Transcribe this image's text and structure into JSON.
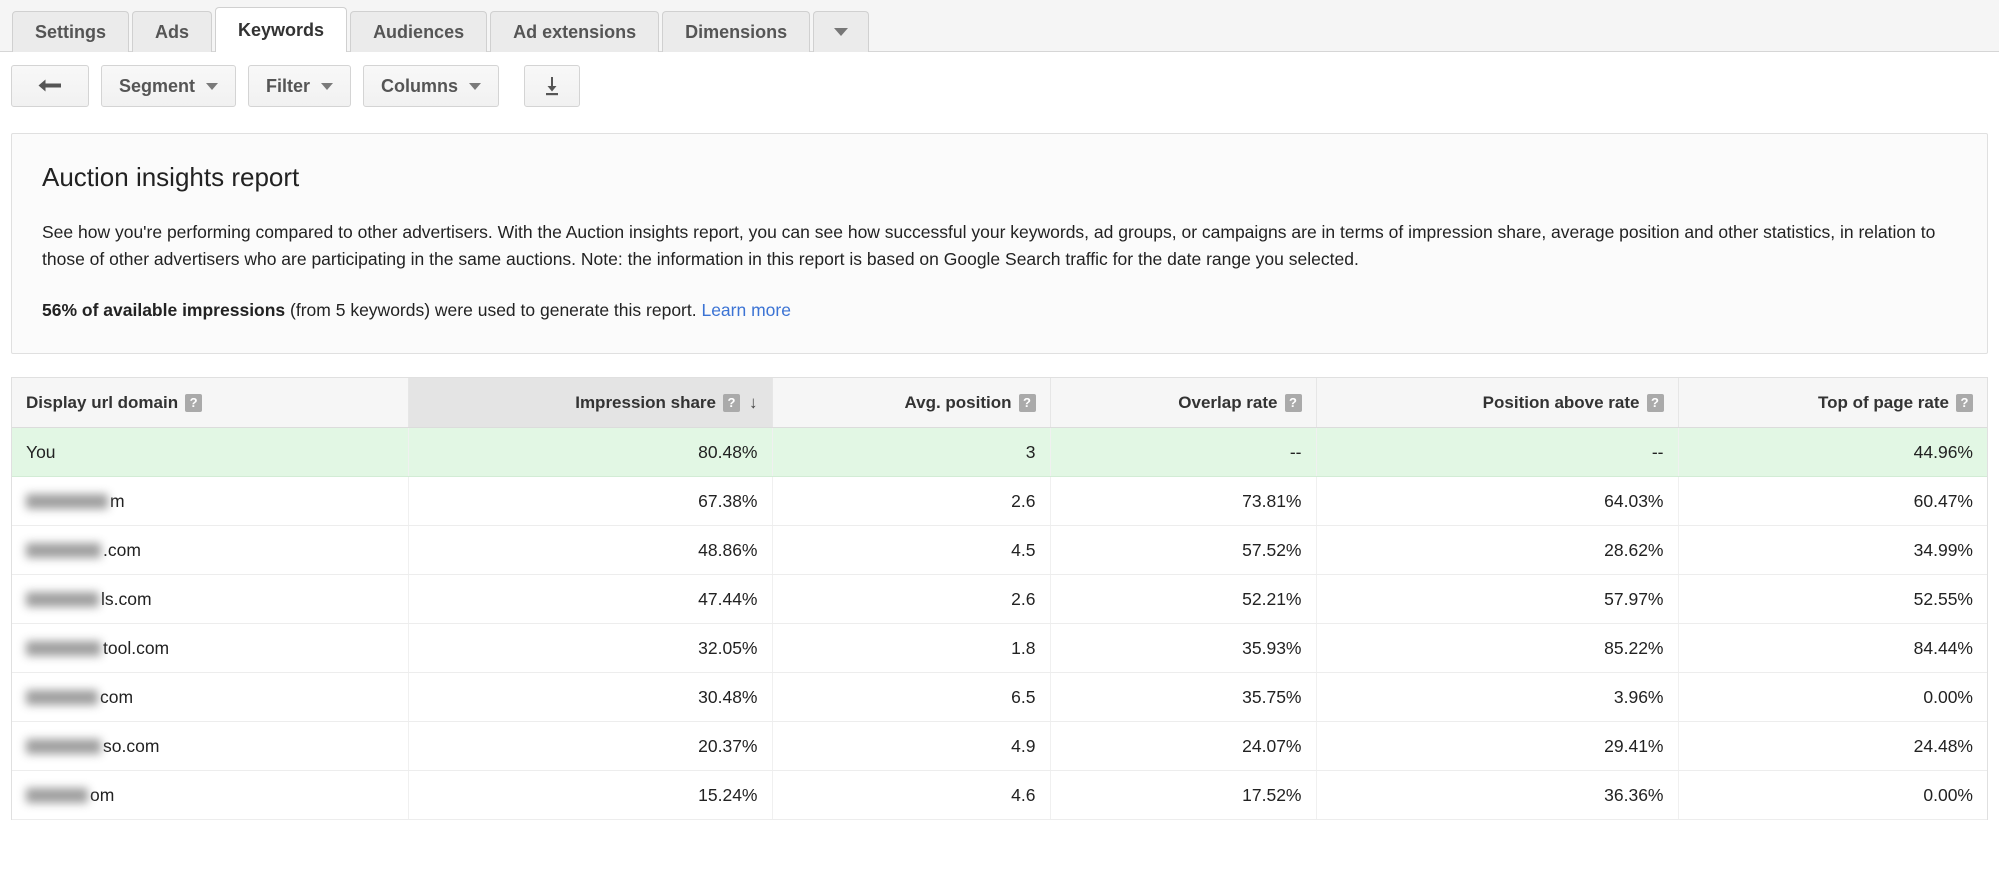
{
  "tabs": [
    {
      "label": "Settings",
      "active": false
    },
    {
      "label": "Ads",
      "active": false
    },
    {
      "label": "Keywords",
      "active": true
    },
    {
      "label": "Audiences",
      "active": false
    },
    {
      "label": "Ad extensions",
      "active": false
    },
    {
      "label": "Dimensions",
      "active": false
    }
  ],
  "tab_overflow_icon": "chevron-down-icon",
  "toolbar": {
    "back_icon": "undo-arrow-icon",
    "segment_label": "Segment",
    "filter_label": "Filter",
    "columns_label": "Columns",
    "download_icon": "download-icon"
  },
  "panel": {
    "title": "Auction insights report",
    "description": "See how you're performing compared to other advertisers. With the Auction insights report, you can see how successful your keywords, ad groups, or campaigns are in terms of impression share, average position and other statistics, in relation to those of other advertisers who are participating in the same auctions. Note: the information in this report is based on Google Search traffic for the date range you selected.",
    "note_bold": "56% of available impressions",
    "note_rest": " (from 5 keywords) were used to generate this report. ",
    "learn_more": "Learn more"
  },
  "table": {
    "help_glyph": "?",
    "sort_arrow": "↓",
    "sorted_column": "Impression share",
    "sort_direction": "descending",
    "columns": [
      {
        "label": "Display url domain",
        "help": true,
        "align": "left",
        "sorted": false
      },
      {
        "label": "Impression share",
        "help": true,
        "align": "right",
        "sorted": true
      },
      {
        "label": "Avg. position",
        "help": true,
        "align": "right",
        "sorted": false
      },
      {
        "label": "Overlap rate",
        "help": true,
        "align": "right",
        "sorted": false
      },
      {
        "label": "Position above rate",
        "help": true,
        "align": "right",
        "sorted": false
      },
      {
        "label": "Top of page rate",
        "help": true,
        "align": "right",
        "sorted": false
      }
    ],
    "rows": [
      {
        "domain": "You",
        "redacted_width": 0,
        "impression_share": "80.48%",
        "avg_position": "3",
        "overlap_rate": "--",
        "position_above_rate": "--",
        "top_of_page_rate": "44.96%",
        "is_you": true
      },
      {
        "domain": "m",
        "redacted_width": 82,
        "impression_share": "67.38%",
        "avg_position": "2.6",
        "overlap_rate": "73.81%",
        "position_above_rate": "64.03%",
        "top_of_page_rate": "60.47%",
        "is_you": false
      },
      {
        "domain": ".com",
        "redacted_width": 75,
        "impression_share": "48.86%",
        "avg_position": "4.5",
        "overlap_rate": "57.52%",
        "position_above_rate": "28.62%",
        "top_of_page_rate": "34.99%",
        "is_you": false
      },
      {
        "domain": "ls.com",
        "redacted_width": 73,
        "impression_share": "47.44%",
        "avg_position": "2.6",
        "overlap_rate": "52.21%",
        "position_above_rate": "57.97%",
        "top_of_page_rate": "52.55%",
        "is_you": false
      },
      {
        "domain": "tool.com",
        "redacted_width": 75,
        "impression_share": "32.05%",
        "avg_position": "1.8",
        "overlap_rate": "35.93%",
        "position_above_rate": "85.22%",
        "top_of_page_rate": "84.44%",
        "is_you": false
      },
      {
        "domain": "com",
        "redacted_width": 72,
        "impression_share": "30.48%",
        "avg_position": "6.5",
        "overlap_rate": "35.75%",
        "position_above_rate": "3.96%",
        "top_of_page_rate": "0.00%",
        "is_you": false
      },
      {
        "domain": "so.com",
        "redacted_width": 75,
        "impression_share": "20.37%",
        "avg_position": "4.9",
        "overlap_rate": "24.07%",
        "position_above_rate": "29.41%",
        "top_of_page_rate": "24.48%",
        "is_you": false
      },
      {
        "domain": "om",
        "redacted_width": 62,
        "impression_share": "15.24%",
        "avg_position": "4.6",
        "overlap_rate": "17.52%",
        "position_above_rate": "36.36%",
        "top_of_page_rate": "0.00%",
        "is_you": false
      }
    ]
  },
  "colors": {
    "link": "#3b73d4",
    "you_row_highlight": "#e2f7e4",
    "sorted_header": "#e4e4e4"
  }
}
